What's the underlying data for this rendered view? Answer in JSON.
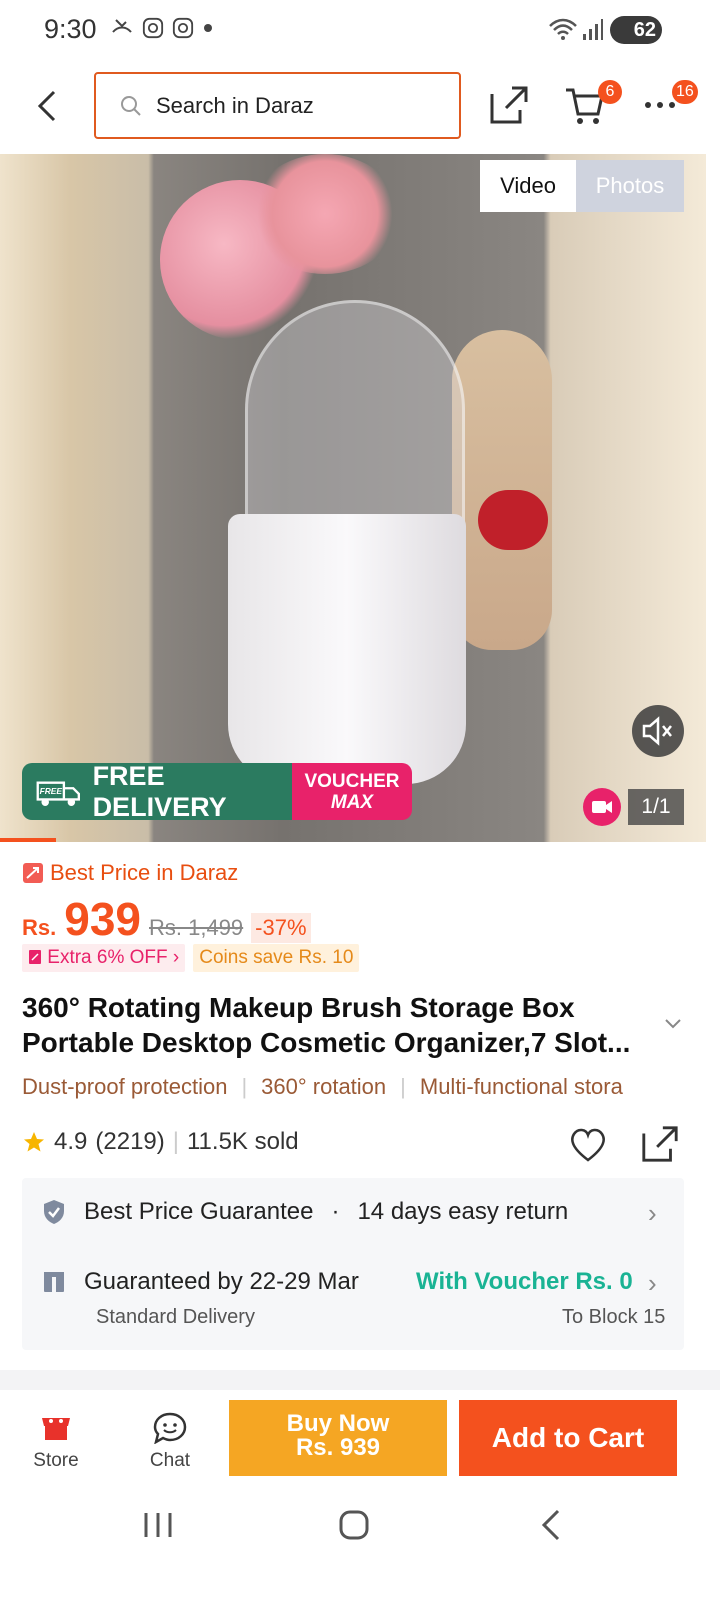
{
  "status": {
    "time": "9:30",
    "battery": "62"
  },
  "header": {
    "search_placeholder": "Search in Daraz",
    "cart_badge": "6",
    "more_badge": "16"
  },
  "media": {
    "tabs": [
      "Video",
      "Photos"
    ],
    "active_tab": "Video",
    "counter": "1/1",
    "promo_free": "FREE",
    "promo_delivery": "FREE DELIVERY",
    "promo_voucher_line1": "VOUCHER",
    "promo_voucher_line2": "MAX"
  },
  "product": {
    "best_price": "Best Price in Daraz",
    "currency": "Rs.",
    "price": "939",
    "old_price": "Rs. 1,499",
    "discount": "-37%",
    "chip_extra": "Extra 6% OFF",
    "chip_coins": "Coins save Rs. 10",
    "title": "360° Rotating Makeup Brush Storage Box Portable Desktop Cosmetic Organizer,7 Slot...",
    "features": [
      "Dust-proof protection",
      "360° rotation",
      "Multi-functional stora"
    ],
    "rating": "4.9",
    "reviews": "(2219)",
    "sold": "11.5K sold"
  },
  "guarantee": {
    "line1_a": "Best Price Guarantee",
    "line1_dot": "·",
    "line1_b": "14 days easy return",
    "line2": "Guaranteed by 22-29 Mar",
    "voucher": "With Voucher Rs. 0",
    "delivery_type": "Standard Delivery",
    "to_block": "To Block 15"
  },
  "bottom": {
    "store": "Store",
    "chat": "Chat",
    "buy_line1": "Buy Now",
    "buy_line2": "Rs. 939",
    "add_to_cart": "Add to Cart"
  },
  "colors": {
    "accent": "#f4511e",
    "teal": "#1ab394",
    "buy": "#f5a623",
    "delivery_green": "#2b7b60",
    "voucher_pink": "#e8226a"
  }
}
